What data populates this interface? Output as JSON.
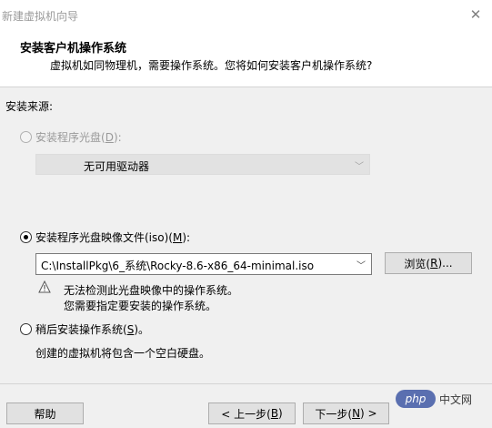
{
  "window": {
    "title": "新建虚拟机向导",
    "close_icon": "close-icon"
  },
  "header": {
    "title": "安装客户机操作系统",
    "subtitle": "虚拟机如同物理机，需要操作系统。您将如何安装客户机操作系统?"
  },
  "source": {
    "label": "安装来源:",
    "option_disc": {
      "label_prefix": "安装程序光盘(",
      "mnemonic": "D",
      "label_suffix": "):",
      "selected": false,
      "enabled": false
    },
    "disc_dropdown": {
      "value": "无可用驱动器",
      "enabled": false
    },
    "option_iso": {
      "label_prefix": "安装程序光盘映像文件(iso)(",
      "mnemonic": "M",
      "label_suffix": "):",
      "selected": true,
      "enabled": true
    },
    "iso_path": {
      "value": "C:\\InstallPkg\\6_系统\\Rocky-8.6-x86_64-minimal.iso"
    },
    "browse_button": {
      "label_prefix": "浏览(",
      "mnemonic": "R",
      "label_suffix": ")..."
    },
    "warning": {
      "icon": "warning-icon",
      "line1": "无法检测此光盘映像中的操作系统。",
      "line2": "您需要指定要安装的操作系统。"
    },
    "option_later": {
      "label_prefix": "稍后安装操作系统(",
      "mnemonic": "S",
      "label_suffix": ")。",
      "selected": false,
      "enabled": true
    },
    "later_description": "创建的虚拟机将包含一个空白硬盘。"
  },
  "footer": {
    "help_label": "帮助",
    "back": {
      "label_prefix": "< 上一步(",
      "mnemonic": "B",
      "label_suffix": ")"
    },
    "next": {
      "label_prefix": "下一步(",
      "mnemonic": "N",
      "label_suffix": ") >"
    }
  },
  "watermark": {
    "logo": "php",
    "text": "中文网"
  },
  "colors": {
    "header_bg": "#ffffff",
    "body_bg": "#f0f0f0",
    "disabled_text": "#9a9a9a",
    "button_bg": "#e1e1e1"
  }
}
